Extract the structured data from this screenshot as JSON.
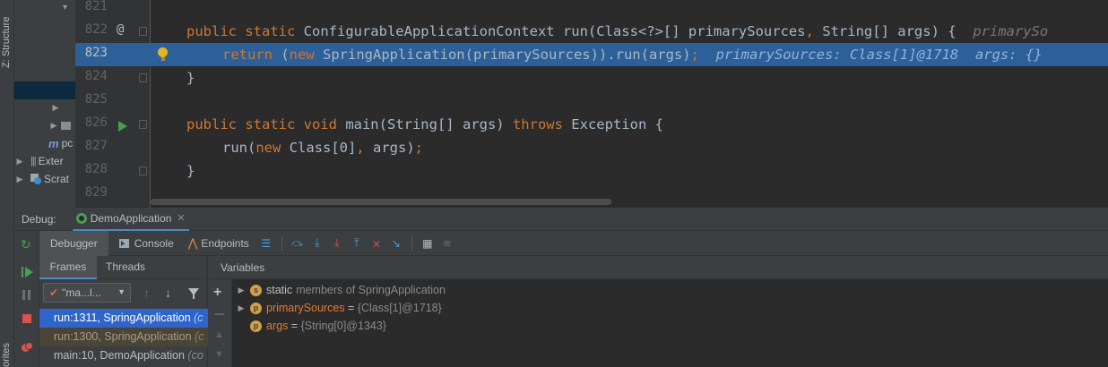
{
  "sidebar": {
    "structure_tab": "Z: Structure",
    "favorites_tab": "orites"
  },
  "tree": {
    "items": [
      {
        "label": ""
      },
      {
        "label": ""
      },
      {
        "label": "pc"
      },
      {
        "label": "Exter"
      },
      {
        "label": "Scrat"
      }
    ]
  },
  "editor": {
    "line_numbers": [
      "821",
      "822",
      "823",
      "824",
      "825",
      "826",
      "827",
      "828",
      "829"
    ],
    "lines": {
      "l822": {
        "code_a": "public static ",
        "code_b": "ConfigurableApplicationContext run(Class<?>[] primarySources",
        "code_c": ", ",
        "code_d": "String[] args) {",
        "hint": "primarySo"
      },
      "l823": {
        "kw_return": "return",
        "code_a": " (",
        "kw_new": "new",
        "code_b": " SpringApplication(primarySources)).run(args)",
        "semi": ";",
        "hint": "primarySources: Class[1]@1718  args: {}"
      },
      "l824": {
        "code": "}"
      },
      "l826": {
        "kw": "public static void",
        "code_a": " main(String[] args) ",
        "kw_throws": "throws",
        "code_b": " Exception {"
      },
      "l827": {
        "code_a": "run(",
        "kw_new": "new",
        "code_b": " Class[0]",
        "comma": ",",
        "code_c": " args)",
        "semi": ";"
      },
      "l828": {
        "code": "}"
      }
    }
  },
  "debug": {
    "title_label": "Debug:",
    "session_tab": "DemoApplication",
    "toolbar": {
      "debugger_tab": "Debugger",
      "console_tab": "Console",
      "endpoints_tab": "Endpoints"
    },
    "frames": {
      "tab_frames": "Frames",
      "tab_threads": "Threads",
      "thread_select": "\"ma...l...",
      "rows": [
        {
          "label": "run:1311, SpringApplication",
          "suffix": "(c"
        },
        {
          "label": "run:1300, SpringApplication",
          "suffix": "(c"
        },
        {
          "label": "main:10, DemoApplication",
          "suffix": "(co"
        }
      ]
    },
    "variables": {
      "header": "Variables",
      "rows": [
        {
          "badge": "s",
          "name": "static",
          "value": "members of SpringApplication"
        },
        {
          "badge": "p",
          "name": "primarySources",
          "eq": " = ",
          "value": "{Class[1]@1718}"
        },
        {
          "badge": "p",
          "name": "args",
          "eq": " = ",
          "value": "{String[0]@1343}"
        }
      ]
    }
  },
  "colors": {
    "keyword": "#cc7832",
    "selection": "#2d6099",
    "frame_selected": "#2f65ca",
    "frame_secondary": "#4b4539",
    "var_name": "#e37b2f"
  }
}
